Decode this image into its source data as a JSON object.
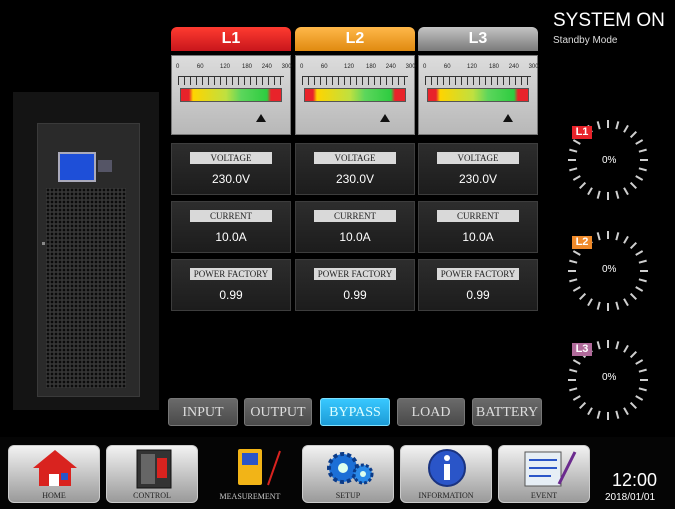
{
  "system": {
    "status": "SYSTEM ON",
    "mode": "Standby Mode"
  },
  "phases": [
    {
      "name": "L1",
      "color": "#e8232a",
      "scale": [
        "0",
        "60",
        "120",
        "180",
        "240",
        "300"
      ],
      "pointer_fraction": 0.78,
      "voltage_label": "VOLTAGE",
      "voltage": "230.0V",
      "current_label": "CURRENT",
      "current": "10.0A",
      "pf_label": "POWER FACTORY",
      "pf": "0.99"
    },
    {
      "name": "L2",
      "color": "#f5a623",
      "scale": [
        "0",
        "60",
        "120",
        "180",
        "240",
        "300"
      ],
      "pointer_fraction": 0.78,
      "voltage_label": "VOLTAGE",
      "voltage": "230.0V",
      "current_label": "CURRENT",
      "current": "10.0A",
      "pf_label": "POWER FACTORY",
      "pf": "0.99"
    },
    {
      "name": "L3",
      "color": "#9a9a9a",
      "scale": [
        "0",
        "60",
        "120",
        "180",
        "240",
        "300"
      ],
      "pointer_fraction": 0.78,
      "voltage_label": "VOLTAGE",
      "voltage": "230.0V",
      "current_label": "CURRENT",
      "current": "10.0A",
      "pf_label": "POWER FACTORY",
      "pf": "0.99"
    }
  ],
  "measure_tabs": [
    {
      "label": "INPUT",
      "active": false
    },
    {
      "label": "OUTPUT",
      "active": false
    },
    {
      "label": "BYPASS",
      "active": true
    },
    {
      "label": "LOAD",
      "active": false
    },
    {
      "label": "BATTERY",
      "active": false
    }
  ],
  "load_gauges": [
    {
      "label": "L1",
      "value": "0%",
      "color": "#e8232a"
    },
    {
      "label": "L2",
      "value": "0%",
      "color": "#f08a2a"
    },
    {
      "label": "L3",
      "value": "0%",
      "color": "#b06a9a"
    }
  ],
  "nav": [
    {
      "label": "HOME",
      "icon": "house-icon"
    },
    {
      "label": "CONTROL",
      "icon": "control-panel-icon"
    },
    {
      "label": "MEASUREMENT",
      "icon": "measurement-meter-icon"
    },
    {
      "label": "SETUP",
      "icon": "gears-icon"
    },
    {
      "label": "INFORMATION",
      "icon": "info-icon"
    },
    {
      "label": "EVENT",
      "icon": "event-log-icon"
    }
  ],
  "clock": {
    "time": "12:00",
    "date": "2018/01/01"
  }
}
